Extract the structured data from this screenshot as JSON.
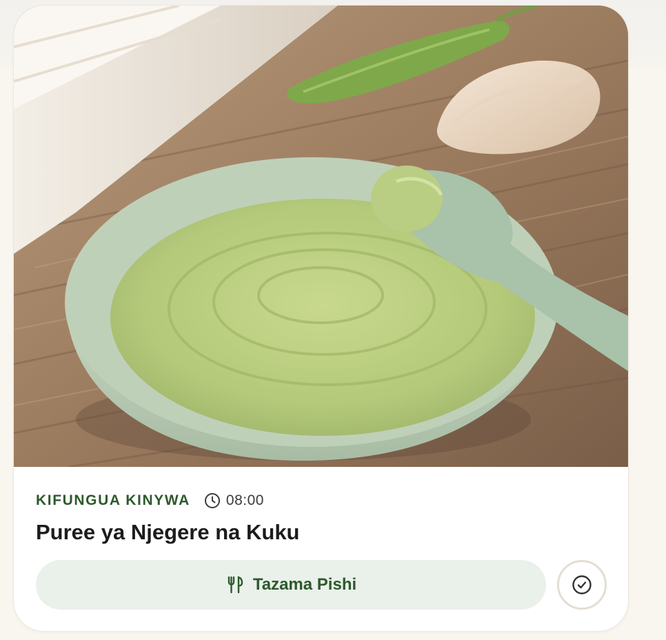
{
  "meal_card": {
    "image": {
      "subject": "bowl-of-green-puree-with-spoon",
      "icon": "food-photo"
    },
    "category": "KIFUNGUA KINYWA",
    "time": "08:00",
    "title": "Puree ya Njegere na Kuku",
    "view_recipe_label": "Tazama Pishi",
    "icons": {
      "time": "clock-icon",
      "recipe": "fork-knife-icon",
      "done": "check-circle-icon"
    }
  },
  "colors": {
    "accent": "#2d5a2c",
    "button_bg": "#eaf0ea",
    "page_bg": "#f9f6f0",
    "card_bg": "#ffffff",
    "done_border": "#e3ded3"
  }
}
